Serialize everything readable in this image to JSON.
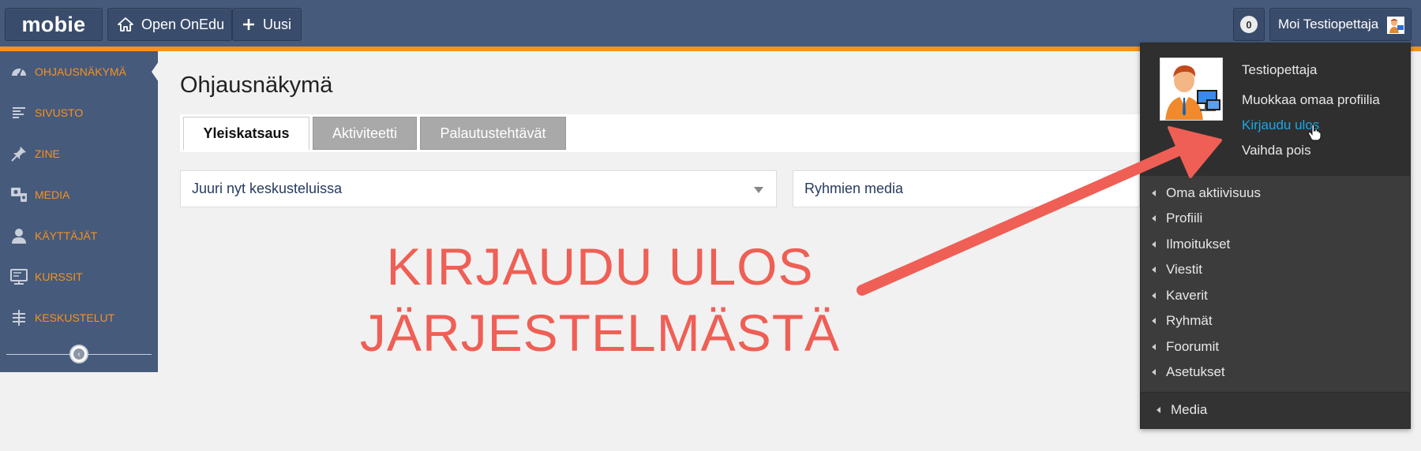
{
  "topbar": {
    "logo": "mobie",
    "open_label": "Open OnEdu",
    "new_label": "Uusi",
    "notification_count": "0",
    "user_greeting": "Moi Testiopettaja"
  },
  "sidebar": {
    "items": [
      {
        "label": "OHJAUSNÄKYMÄ",
        "icon": "dashboard-icon"
      },
      {
        "label": "SIVUSTO",
        "icon": "site-icon"
      },
      {
        "label": "ZINE",
        "icon": "pin-icon"
      },
      {
        "label": "MEDIA",
        "icon": "media-icon"
      },
      {
        "label": "KÄYTTÄJÄT",
        "icon": "user-icon"
      },
      {
        "label": "KURSSIT",
        "icon": "course-icon"
      },
      {
        "label": "KESKUSTELUT",
        "icon": "discussion-icon"
      }
    ]
  },
  "main": {
    "title": "Ohjausnäkymä",
    "tabs": [
      {
        "label": "Yleiskatsaus"
      },
      {
        "label": "Aktiviteetti"
      },
      {
        "label": "Palautustehtävät"
      }
    ],
    "panels": [
      {
        "label": "Juuri nyt keskusteluissa"
      },
      {
        "label": "Ryhmien media"
      }
    ]
  },
  "annotation": {
    "line1": "KIRJAUDU ULOS",
    "line2": "JÄRJESTELMÄSTÄ",
    "color": "#ef5f55"
  },
  "dropdown": {
    "name": "Testiopettaja",
    "edit_profile": "Muokkaa omaa profiilia",
    "logout": "Kirjaudu ulos",
    "switch": "Vaihda pois",
    "menu": [
      {
        "label": "Oma aktiivisuus"
      },
      {
        "label": "Profiili"
      },
      {
        "label": "Ilmoitukset"
      },
      {
        "label": "Viestit"
      },
      {
        "label": "Kaverit"
      },
      {
        "label": "Ryhmät"
      },
      {
        "label": "Foorumit"
      },
      {
        "label": "Asetukset"
      }
    ],
    "bottom": "Media"
  },
  "colors": {
    "topbar": "#465a7c",
    "accent": "#f7921e",
    "link": "#19a7e8"
  }
}
